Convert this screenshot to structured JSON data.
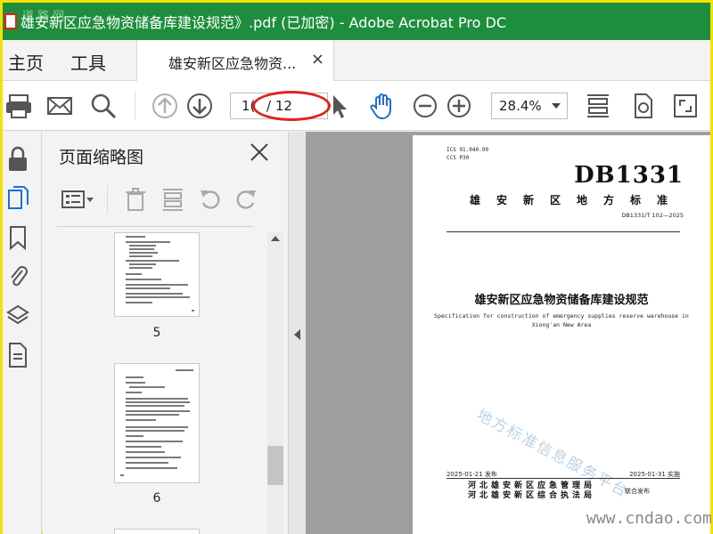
{
  "window": {
    "title": "雄安新区应急物资储备库建设规范》.pdf  (已加密)  - Adobe Acrobat Pro DC",
    "corner_watermark": "道 路 网"
  },
  "menu": {
    "home": "主页",
    "tools": "工具"
  },
  "doc_tab": {
    "label": "雄安新区应急物资...",
    "close": "×"
  },
  "toolbar": {
    "current_page": "1(",
    "total_pages": "/ 12",
    "zoom": "28.4%"
  },
  "panel": {
    "title": "页面缩略图",
    "thumbnails": [
      {
        "label": "5"
      },
      {
        "label": "6"
      }
    ]
  },
  "document": {
    "ics": "ICS  91.040.99",
    "ccs": "CCS  P30",
    "standard": "DB1331",
    "standard_name": "雄安新区地方标准",
    "standard_code": "DB1331/T 102—2025",
    "title_cn": "雄安新区应急物资储备库建设规范",
    "title_en_1": "Specification for construction of emergency supplies reserve warehouse in",
    "title_en_2": "Xiong'an New Area",
    "watermark": "地方标准信息服务平台",
    "issue_date": "2025-01-21 发布",
    "impl_date": "2025-01-31 实施",
    "issuer_1": "河北雄安新区应急管理局",
    "issuer_2": "河北雄安新区综合执法局",
    "joint": "联合发布"
  },
  "site_watermark": "www.cndao.com",
  "colors": {
    "titlebar": "#1e8e3e",
    "highlight_oval": "#e0241c",
    "frame": "#f5e000"
  }
}
